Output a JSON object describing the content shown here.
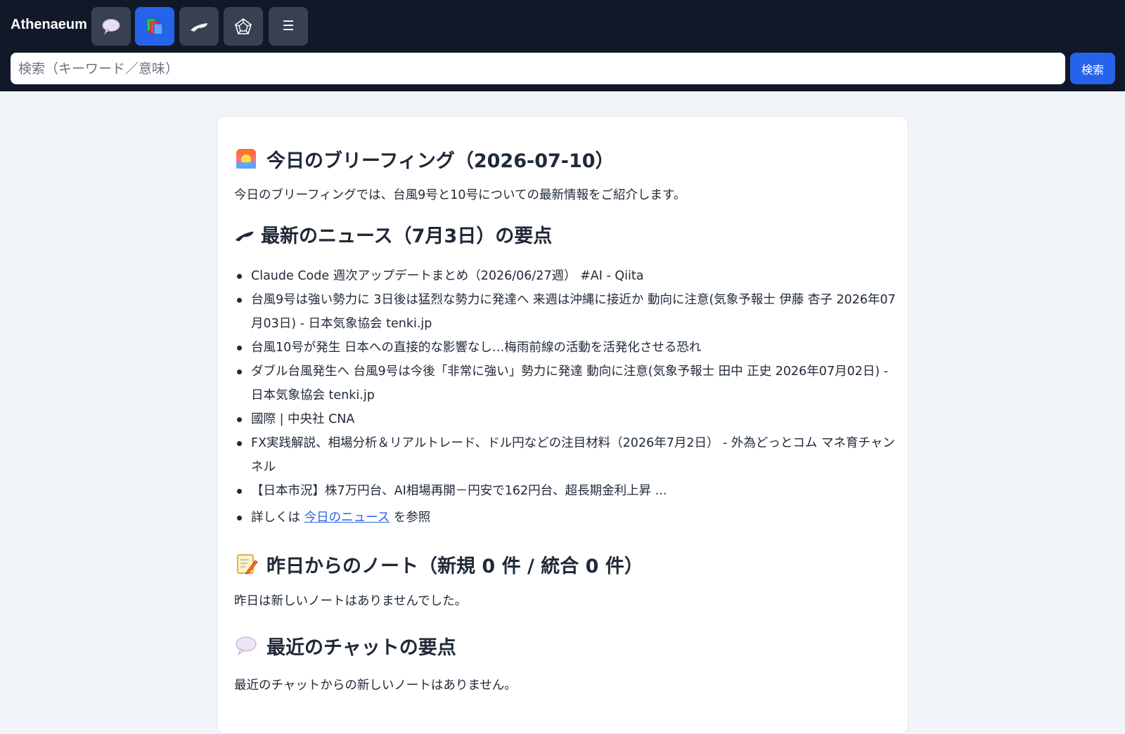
{
  "app": {
    "brand": "Athenaeum"
  },
  "nav": {
    "buttons": [
      {
        "icon": "chat-bubble-icon",
        "active": false
      },
      {
        "icon": "books-icon",
        "active": true
      },
      {
        "icon": "newspaper-icon",
        "active": false
      },
      {
        "icon": "network-graph-icon",
        "active": false
      },
      {
        "icon": "menu-icon",
        "active": false
      }
    ],
    "menu_glyph": "☰"
  },
  "search": {
    "placeholder": "検索（キーワード／意味）",
    "value": "",
    "button_label": "検索"
  },
  "briefing": {
    "title": "今日のブリーフィング（2026-07-10）",
    "intro": "今日のブリーフィングでは、台風9号と10号についての最新情報をご紹介します。",
    "news_heading": "最新のニュース（7月3日）の要点",
    "news_items": [
      "Claude Code 週次アップデートまとめ（2026/06/27週） #AI - Qiita",
      "台風9号は強い勢力に 3日後は猛烈な勢力に発達へ 来週は沖縄に接近か 動向に注意(気象予報士 伊藤 杏子 2026年07月03日) - 日本気象協会 tenki.jp",
      "台風10号が発生 日本への直接的な影響なし…梅雨前線の活動を活発化させる恐れ",
      "ダブル台風発生へ 台風9号は今後「非常に強い」勢力に発達 動向に注意(気象予報士 田中 正史 2026年07月02日) - 日本気象協会 tenki.jp",
      "國際 | 中央社 CNA",
      "FX実践解説、相場分析＆リアルトレード、ドル円などの注目材料（2026年7月2日） - 外為どっとコム マネ育チャンネル",
      "【日本市況】株7万円台、AI相場再開－円安で162円台、超長期金利上昇 ..."
    ],
    "details_prefix": "詳しくは",
    "details_link": "今日のニュース",
    "details_suffix": "を参照",
    "notes_heading": "昨日からのノート（新規 0 件 / 統合 0 件）",
    "notes_body": "昨日は新しいノートはありませんでした。",
    "chat_heading": "最近のチャットの要点",
    "chat_body": "最近のチャットからの新しいノートはありません。"
  },
  "colors": {
    "header_bg": "#111827",
    "nav_button_bg": "#374151",
    "accent": "#2563eb",
    "page_bg": "#f1f5f9",
    "card_bg": "#ffffff"
  }
}
